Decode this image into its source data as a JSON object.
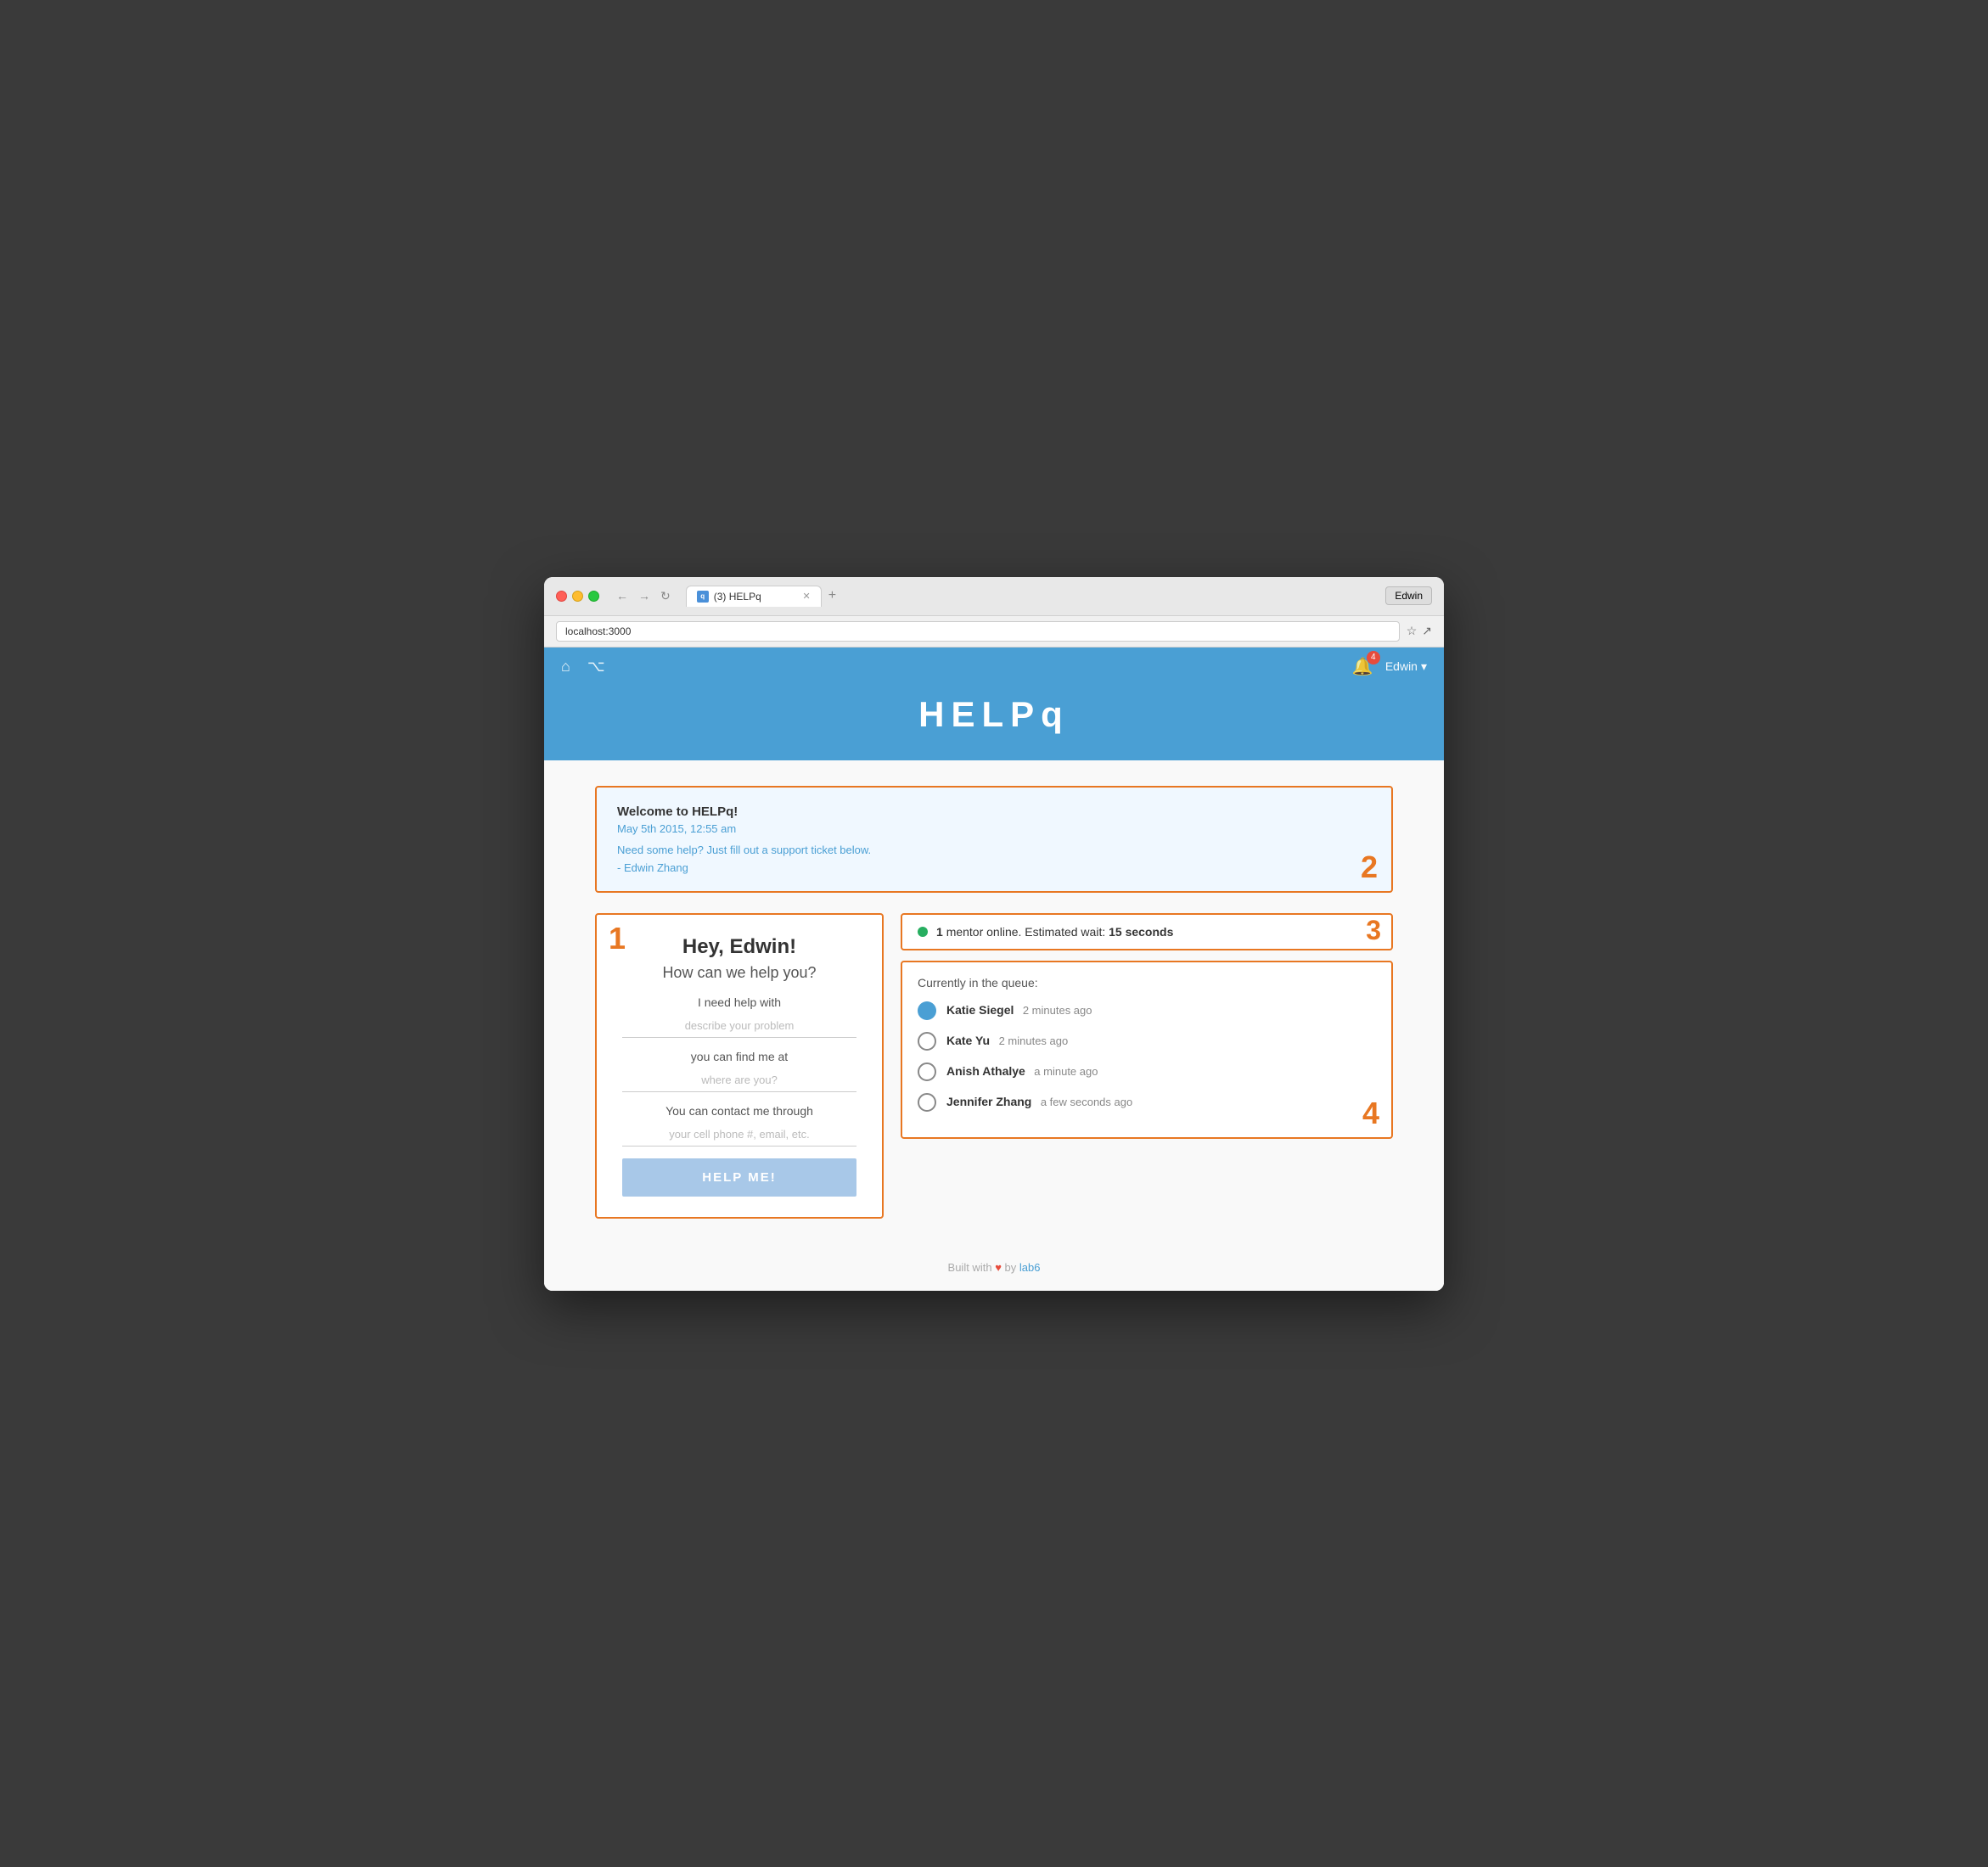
{
  "browser": {
    "tab_title": "(3) HELPq",
    "address": "localhost:3000",
    "user_btn": "Edwin",
    "new_tab_btn": "+"
  },
  "header": {
    "title": "HELPq",
    "notification_count": "4",
    "user_name": "Edwin"
  },
  "welcome_panel": {
    "number": "2",
    "title": "Welcome to HELPq!",
    "date": "May 5th 2015, 12:55 am",
    "message": "Need some help? Just fill out a support ticket below.",
    "author": "- Edwin Zhang"
  },
  "form_panel": {
    "number": "1",
    "greeting": "Hey, Edwin!",
    "subtitle": "How can we help you?",
    "label1": "I need help with",
    "input1_placeholder": "describe your problem",
    "label2": "you can find me at",
    "input2_placeholder": "where are you?",
    "label3": "You can contact me through",
    "input3_placeholder": "your cell phone #, email, etc.",
    "submit_label": "HELP ME!"
  },
  "mentor_panel": {
    "number": "3",
    "count": "1",
    "status_text": "mentor online. Estimated wait:",
    "wait_time": "15 seconds"
  },
  "queue_panel": {
    "number": "4",
    "title": "Currently in the queue:",
    "items": [
      {
        "name": "Katie Siegel",
        "time": "2 minutes ago",
        "filled": true
      },
      {
        "name": "Kate Yu",
        "time": "2 minutes ago",
        "filled": false
      },
      {
        "name": "Anish Athalye",
        "time": "a minute ago",
        "filled": false
      },
      {
        "name": "Jennifer Zhang",
        "time": "a few seconds ago",
        "filled": false
      }
    ]
  },
  "footer": {
    "built_with": "Built with",
    "by_text": "by",
    "link_label": "lab6"
  }
}
